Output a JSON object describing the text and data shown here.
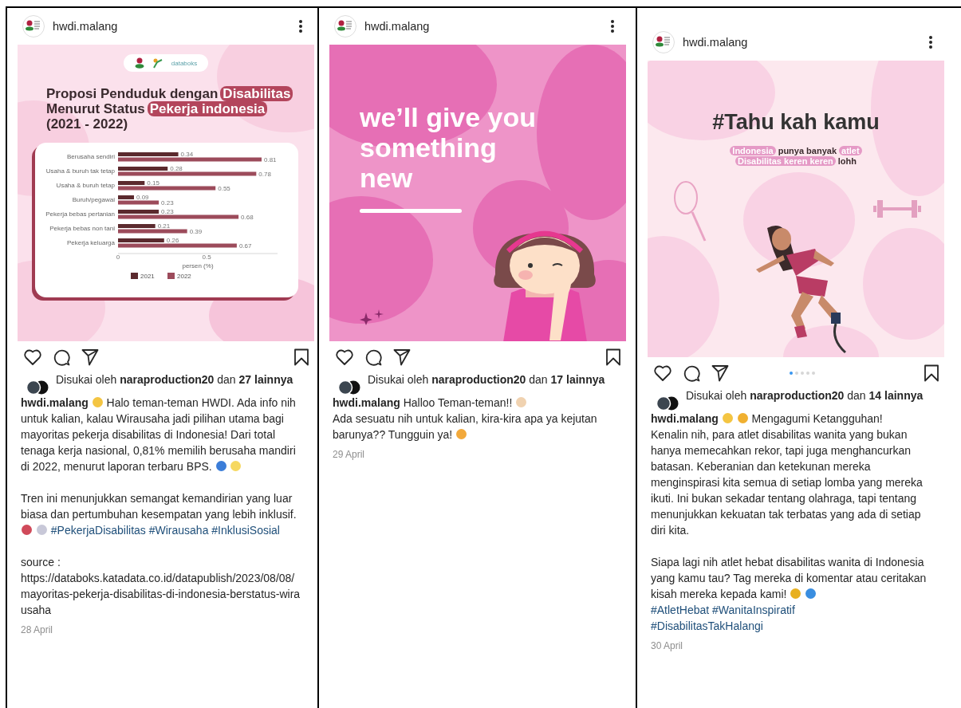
{
  "posts": [
    {
      "user": "hwdi.malang",
      "image": {
        "kind": "chart",
        "brand": "databoks",
        "title_lines": [
          [
            {
              "text": "Proposi Penduduk dengan",
              "highlight": false
            },
            {
              "text": "Disabilitas",
              "highlight": true
            }
          ],
          [
            {
              "text": "Menurut Status",
              "highlight": false
            },
            {
              "text": "Pekerja indonesia",
              "highlight": true
            }
          ],
          [
            {
              "text": "(2021 - 2022)",
              "highlight": false
            }
          ]
        ],
        "chart_data": {
          "type": "bar",
          "orientation": "horizontal",
          "categories": [
            "Berusaha sendiri",
            "Usaha & buruh tak tetap",
            "Usaha & buruh tetap",
            "Buruh/pegawai",
            "Pekerja bebas pertanian",
            "Pekerja bebas non tani",
            "Pekerja keluarga"
          ],
          "series": [
            {
              "name": "2021",
              "color": "#5b2a2e",
              "values": [
                0.34,
                0.28,
                0.15,
                0.09,
                0.23,
                0.21,
                0.26
              ]
            },
            {
              "name": "2022",
              "color": "#9c4b5b",
              "values": [
                0.81,
                0.78,
                0.55,
                0.23,
                0.68,
                0.39,
                0.67
              ]
            }
          ],
          "xlabel": "persen (%)",
          "xticks": [
            0,
            0.5
          ],
          "xlim": [
            0,
            0.9
          ],
          "legend": "bottom",
          "data_labels": true
        }
      },
      "liked": "Disukai oleh **naraproduction20** dan **27 lainnya**",
      "caption": [
        [
          {
            "kind": "user",
            "text": "hwdi.malang"
          },
          {
            "kind": "emoji",
            "color": "#f4c542"
          },
          {
            "kind": "text",
            "text": "Halo teman-teman HWDI. Ada info nih untuk kalian, kalau Wirausaha jadi pilihan utama bagi mayoritas pekerja disabilitas di Indonesia! Dari total tenaga kerja nasional, 0,81% memilih berusaha mandiri di 2022, menurut laporan terbaru BPS."
          },
          {
            "kind": "emoji",
            "color": "#3b7dd8"
          },
          {
            "kind": "emoji",
            "color": "#f6d860"
          }
        ],
        [
          {
            "kind": "text",
            "text": "Tren ini menunjukkan semangat kemandirian yang luar biasa dan pertumbuhan kesempatan yang lebih inklusif."
          },
          {
            "kind": "emoji",
            "color": "#d04a5a"
          },
          {
            "kind": "emoji",
            "color": "#c8c8d8"
          },
          {
            "kind": "tag",
            "text": "#PekerjaDisabilitas"
          },
          {
            "kind": "tag",
            "text": "#Wirausaha"
          },
          {
            "kind": "tag",
            "text": "#InklusiSosial"
          }
        ],
        [
          {
            "kind": "text",
            "text": "source :"
          },
          {
            "kind": "newline"
          },
          {
            "kind": "url",
            "text": "https://databoks.katadata.co.id/datapublish/2023/08/08/mayoritas-pekerja-disabilitas-di-indonesia-berstatus-wirausaha"
          }
        ]
      ],
      "date": "28 April"
    },
    {
      "user": "hwdi.malang",
      "image": {
        "kind": "promo",
        "headline_lines": [
          "we’ll give you",
          "something",
          "new"
        ]
      },
      "liked": "Disukai oleh **naraproduction20** dan **17 lainnya**",
      "caption": [
        [
          {
            "kind": "user",
            "text": "hwdi.malang"
          },
          {
            "kind": "text",
            "text": "Halloo Teman-teman!!"
          },
          {
            "kind": "emoji",
            "color": "#f0d2b0"
          },
          {
            "kind": "newline"
          },
          {
            "kind": "text",
            "text": "Ada sesuatu nih untuk kalian, kira-kira apa ya kejutan barunya?? Tungguin ya!"
          },
          {
            "kind": "emoji",
            "color": "#f2a93b"
          }
        ]
      ],
      "date": "29 April"
    },
    {
      "user": "hwdi.malang",
      "image": {
        "kind": "fact",
        "headline": "#Tahu kah kamu",
        "sub_lines": [
          [
            {
              "text": "Indonesia",
              "highlight": true
            },
            {
              "text": "punya banyak",
              "highlight": false
            },
            {
              "text": "atlet",
              "highlight": true
            }
          ],
          [
            {
              "text": "Disabilitas keren keren",
              "highlight": true
            },
            {
              "text": "lohh",
              "highlight": false
            }
          ]
        ]
      },
      "dots": [
        {
          "selected": true
        },
        {
          "selected": false
        },
        {
          "selected": false
        },
        {
          "selected": false
        },
        {
          "selected": false
        }
      ],
      "liked": "Disukai oleh **naraproduction20** dan **14 lainnya**",
      "caption": [
        [
          {
            "kind": "user",
            "text": "hwdi.malang"
          },
          {
            "kind": "emoji",
            "color": "#f4c542"
          },
          {
            "kind": "emoji",
            "color": "#f0b030"
          },
          {
            "kind": "text",
            "text": "Mengagumi Ketangguhan!"
          },
          {
            "kind": "newline"
          },
          {
            "kind": "text",
            "text": "Kenalin nih, para atlet disabilitas wanita yang bukan hanya memecahkan rekor, tapi juga menghancurkan batasan. Keberanian dan ketekunan mereka menginspirasi kita semua di setiap lomba yang mereka ikuti. Ini bukan sekadar tentang olahraga, tapi tentang menunjukkan kekuatan tak terbatas yang ada di setiap diri kita."
          }
        ],
        [
          {
            "kind": "text",
            "text": "Siapa lagi nih atlet hebat disabilitas wanita di Indonesia yang kamu tau? Tag mereka di komentar atau ceritakan kisah mereka kepada kami!"
          },
          {
            "kind": "emoji",
            "color": "#e8b020"
          },
          {
            "kind": "emoji",
            "color": "#3a8ee0"
          },
          {
            "kind": "newline"
          },
          {
            "kind": "tag",
            "text": "#AtletHebat"
          },
          {
            "kind": "tag",
            "text": "#WanitaInspiratif"
          },
          {
            "kind": "newline"
          },
          {
            "kind": "tag",
            "text": "#DisabilitasTakHalangi"
          }
        ]
      ],
      "date": "30 April"
    }
  ]
}
